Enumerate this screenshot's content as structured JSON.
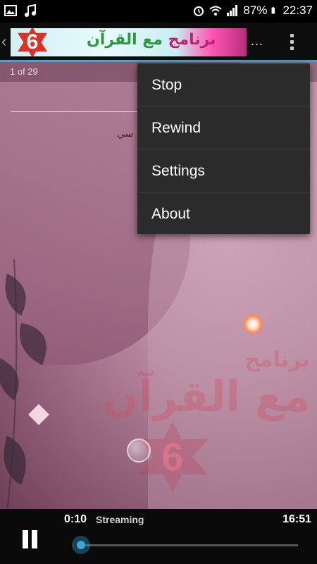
{
  "status_bar": {
    "left_icons": [
      "image-icon",
      "music-note-icon"
    ],
    "right_icons": [
      "alarm-icon",
      "wifi-icon",
      "signal-icon"
    ],
    "battery": "87%",
    "time": "22:37"
  },
  "action_bar": {
    "back_icon": "chevron-left-icon",
    "banner": {
      "number": "6",
      "title_pink": "برنامج",
      "title_green": "مع القرآن"
    },
    "ellipsis": "...",
    "overflow_icon": "more-vertical-icon"
  },
  "content": {
    "pager": "1 of 29",
    "reciter_fragment": "سي",
    "watermark": {
      "line1": "برنامج",
      "line2": "مع القرآن",
      "number": "6"
    }
  },
  "menu": {
    "items": [
      {
        "label": "Stop"
      },
      {
        "label": "Rewind"
      },
      {
        "label": "Settings"
      },
      {
        "label": "About"
      }
    ]
  },
  "player": {
    "pause_icon": "pause-icon",
    "current_time": "0:10",
    "status": "Streaming",
    "total_time": "16:51",
    "progress": 0.0
  },
  "colors": {
    "accent": "#3aa6d8",
    "menu_bg": "#2b2b2b"
  }
}
